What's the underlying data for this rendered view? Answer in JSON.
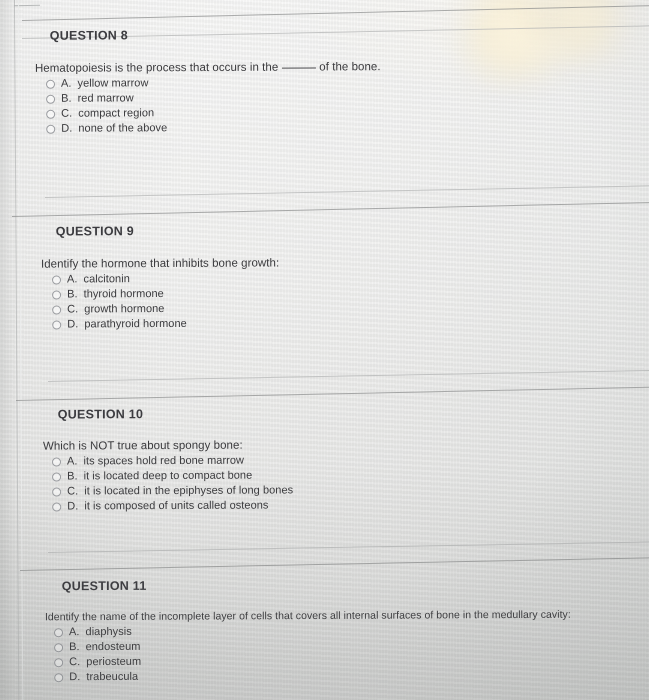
{
  "page": {
    "kind": "online-quiz-screenshot-photo",
    "colors": {
      "screen_background": "#eeeeed",
      "text": "#3a3a3d",
      "heading": "#3c3c40",
      "rule": "#969898",
      "radio_border": "#9a9ca0",
      "glare_warm": "#f8eed2"
    }
  },
  "questions": [
    {
      "heading": "QUESTION 8",
      "stem_before_blank": "Hematopoiesis is the process that occurs in the",
      "stem_after_blank": "of the bone.",
      "options": [
        {
          "letter": "A.",
          "text": "yellow marrow"
        },
        {
          "letter": "B.",
          "text": "red marrow"
        },
        {
          "letter": "C.",
          "text": "compact region"
        },
        {
          "letter": "D.",
          "text": "none of the above"
        }
      ]
    },
    {
      "heading": "QUESTION 9",
      "stem": "Identify the hormone that inhibits bone growth:",
      "options": [
        {
          "letter": "A.",
          "text": "calcitonin"
        },
        {
          "letter": "B.",
          "text": "thyroid hormone"
        },
        {
          "letter": "C.",
          "text": "growth hormone"
        },
        {
          "letter": "D.",
          "text": "parathyroid hormone"
        }
      ]
    },
    {
      "heading": "QUESTION 10",
      "stem": "Which is NOT true about spongy bone:",
      "options": [
        {
          "letter": "A.",
          "text": "its spaces hold red bone marrow"
        },
        {
          "letter": "B.",
          "text": "it is located deep to compact bone"
        },
        {
          "letter": "C.",
          "text": "it is located in the epiphyses of long bones"
        },
        {
          "letter": "D.",
          "text": "it is composed of units called osteons"
        }
      ]
    },
    {
      "heading": "QUESTION 11",
      "stem": "Identify the name of the incomplete layer of cells that covers all internal surfaces of bone in the medullary cavity:",
      "options": [
        {
          "letter": "A.",
          "text": "diaphysis"
        },
        {
          "letter": "B.",
          "text": "endosteum"
        },
        {
          "letter": "C.",
          "text": "periosteum"
        },
        {
          "letter": "D.",
          "text": "trabeucula"
        }
      ]
    }
  ]
}
